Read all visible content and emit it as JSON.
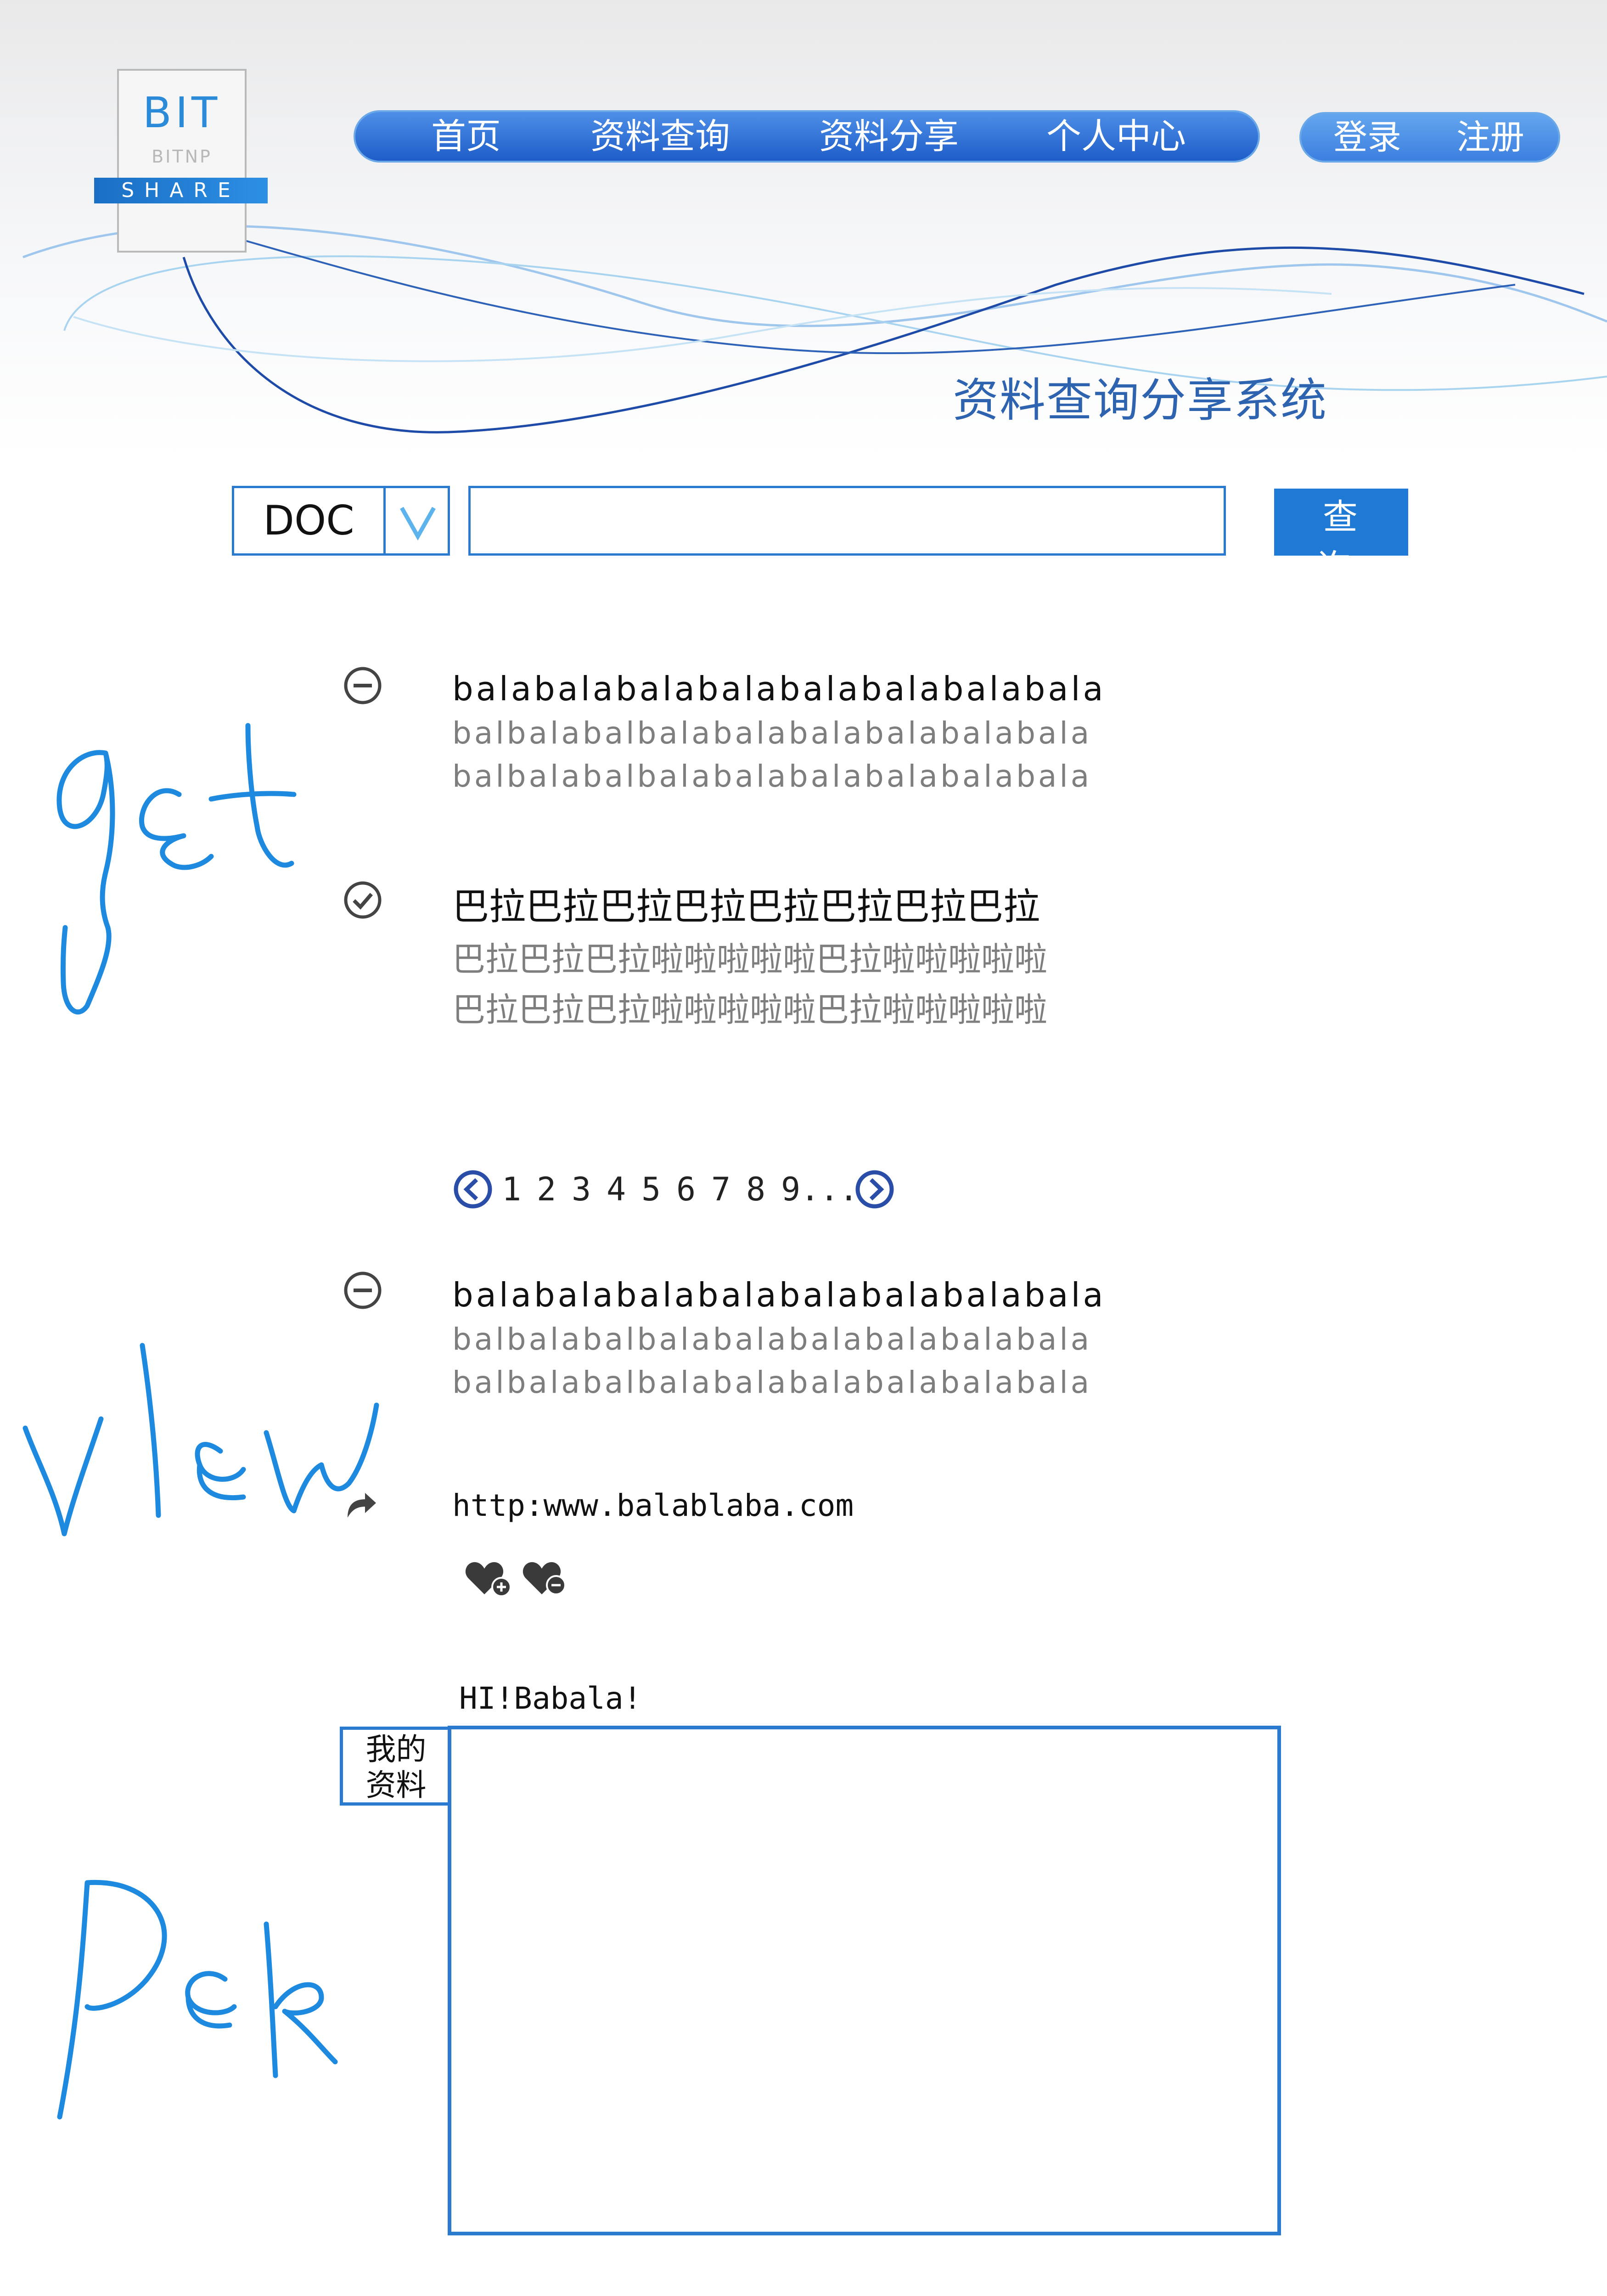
{
  "logo": {
    "main": "BIT",
    "sub": "BITNP",
    "band": "SHARE"
  },
  "nav": {
    "items": [
      "首页",
      "资料查询",
      "资料分享",
      "个人中心"
    ]
  },
  "auth": {
    "login": "登录",
    "register": "注册"
  },
  "system_title": "资料查询分享系统",
  "search": {
    "type_value": "DOC",
    "query_value": "",
    "button_label": "查 询"
  },
  "results_top": [
    {
      "status_icon": "minus-circle-icon",
      "title": "balabalabalabalabalabalabalabala",
      "lines": [
        "balbalabalbalabalabalabalabalabala",
        "balbalabalbalabalabalabalabalabala"
      ]
    },
    {
      "status_icon": "check-circle-icon",
      "title": "巴拉巴拉巴拉巴拉巴拉巴拉巴拉巴拉",
      "lines": [
        "巴拉巴拉巴拉啦啦啦啦啦巴拉啦啦啦啦啦",
        "巴拉巴拉巴拉啦啦啦啦啦巴拉啦啦啦啦啦"
      ]
    }
  ],
  "pagination": {
    "prev_icon": "chevron-left-circle-icon",
    "pages": [
      "1",
      "2",
      "3",
      "4",
      "5",
      "6",
      "7",
      "8",
      "9..."
    ],
    "next_icon": "chevron-right-circle-icon"
  },
  "detail": {
    "status_icon": "minus-circle-icon",
    "title": "balabalabalabalabalabalabalabala",
    "lines": [
      "balbalabalbalabalabalabalabalabala",
      "balbalabalbalabalabalabalabalabala"
    ],
    "share_icon": "share-arrow-icon",
    "url": "http:www.balablaba.com",
    "actions": [
      "heart-plus-icon",
      "heart-minus-icon"
    ]
  },
  "profile": {
    "greeting": "HI!Babala!",
    "tab_line1": "我的",
    "tab_line2": "资料"
  },
  "annotations": [
    "get",
    "view",
    "Per"
  ],
  "colors": {
    "nav_blue": "#1e5dc8",
    "accent_blue": "#2a7ad0",
    "title_blue": "#2e63b0",
    "handwriting_blue": "#1d8ae0"
  }
}
